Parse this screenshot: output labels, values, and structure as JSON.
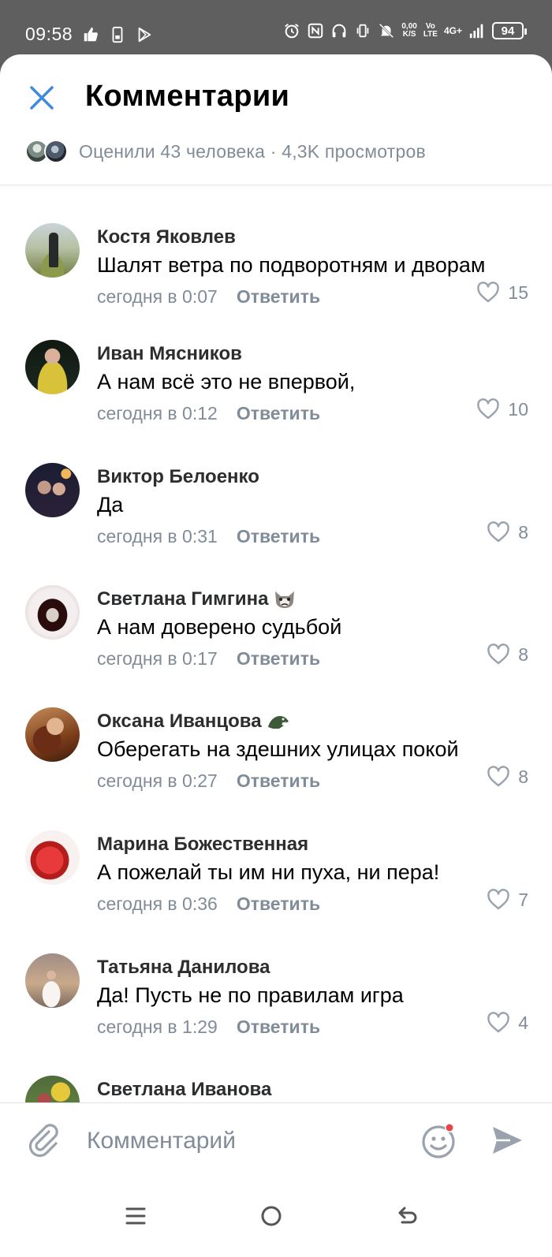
{
  "status_bar": {
    "time": "09:58",
    "net_speed_value": "0,00",
    "net_speed_unit": "K/S",
    "volte_top": "Vo",
    "volte_bottom": "LTE",
    "network": "4G+",
    "battery": "94"
  },
  "header": {
    "title": "Комментарии",
    "likers_text": "Оценили 43 человека · 4,3K просмотров"
  },
  "comments": [
    {
      "author": "Костя Яковлев",
      "text": "Шалят ветра по подворотням и дворам",
      "time": "сегодня в 0:07",
      "reply": "Ответить",
      "likes": "15"
    },
    {
      "author": "Иван Мясников",
      "text": "А нам всё это не впервой,",
      "time": "сегодня в 0:12",
      "reply": "Ответить",
      "likes": "10"
    },
    {
      "author": "Виктор Белоенко",
      "text": "Да",
      "time": "сегодня в 0:31",
      "reply": "Ответить",
      "likes": "8"
    },
    {
      "author": "Светлана Гимгина",
      "text": "А нам доверено судьбой",
      "time": "сегодня в 0:17",
      "reply": "Ответить",
      "likes": "8",
      "emoji": "grumpy-cat-emoji"
    },
    {
      "author": "Оксана Иванцова",
      "text": "Оберегать на здешних улицах покой",
      "time": "сегодня в 0:27",
      "reply": "Ответить",
      "likes": "8",
      "emoji": "dinosaur-emoji"
    },
    {
      "author": "Марина Божественная",
      "text": "А пожелай ты им ни пуха, ни пера!",
      "time": "сегодня в 0:36",
      "reply": "Ответить",
      "likes": "7"
    },
    {
      "author": "Татьяна Данилова",
      "text": "Да! Пусть не по правилам игра",
      "time": "сегодня в 1:29",
      "reply": "Ответить",
      "likes": "4"
    },
    {
      "author": "Светлана Иванова"
    }
  ],
  "composer": {
    "placeholder": "Комментарий"
  },
  "colors": {
    "accent": "#3f8ae0",
    "secondary_text": "#818c99",
    "notification_dot": "#e64646"
  }
}
